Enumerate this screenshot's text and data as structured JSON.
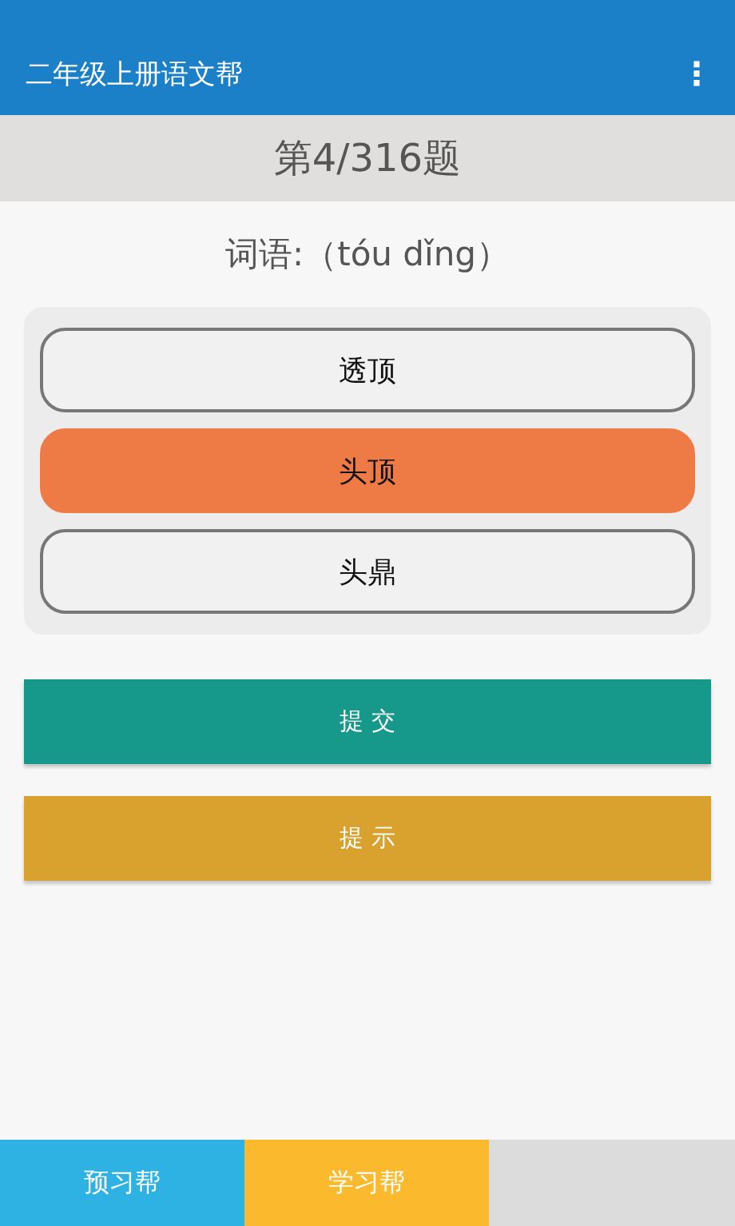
{
  "app_bar": {
    "title": "二年级上册语文帮",
    "menu": "⋮"
  },
  "progress": "第4/316题",
  "question": "词语:（tóu dǐng）",
  "options": [
    {
      "label": "透顶",
      "selected": false
    },
    {
      "label": "头顶",
      "selected": true
    },
    {
      "label": "头鼎",
      "selected": false
    }
  ],
  "actions": [
    {
      "label": "提 交",
      "kind": "submit"
    },
    {
      "label": "提 示",
      "kind": "hint"
    }
  ],
  "bottom_nav": [
    {
      "label": "预习帮",
      "color": "#2eb2e4"
    },
    {
      "label": "学习帮",
      "color": "#fbb92e"
    }
  ]
}
